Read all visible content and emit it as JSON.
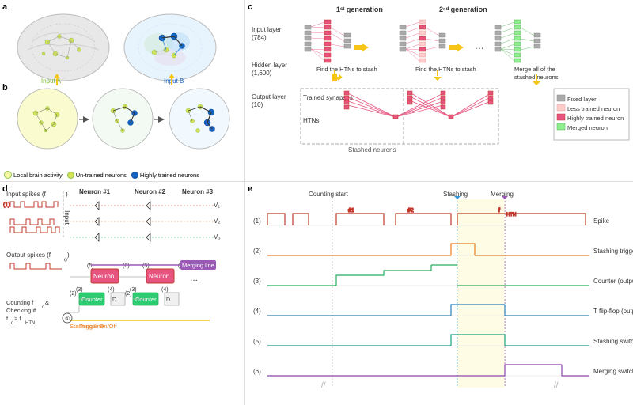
{
  "panels": {
    "a_label": "a",
    "b_label": "b",
    "c_label": "c",
    "d_label": "d",
    "e_label": "e"
  },
  "legend_ab": {
    "local_brain": "Local brain activity",
    "untrained": "Un-trained neurons",
    "highly_trained": "Highly trained neurons"
  },
  "panel_c": {
    "input_layer": "Input layer\n(784)",
    "hidden_layer": "Hidden layer\n(1,600)",
    "output_layer": "Output layer\n(10)",
    "gen1": "1st generation",
    "gen2": "2nd generation",
    "find_htn1": "Find the HTNs to stash",
    "find_htn2": "Find the HTNs to stash",
    "merge_label": "Merge all of the\nstashed neurons",
    "trained_synapses": "Trained synapses",
    "htns": "HTNs",
    "stashed_neurons": "Stashed neurons",
    "legend_fixed": "Fixed layer",
    "legend_less": "Less trained neuron",
    "legend_highly": "Highly trained neuron",
    "legend_merged": "Merged neuron"
  },
  "panel_d": {
    "input_spikes": "Input spikes (fᵢ)",
    "output_spikes": "Output spikes (fₒ)",
    "neuron1": "Neuron #1",
    "neuron2": "Neuron #2",
    "neuron3": "Neuron #3",
    "input_label": "Input",
    "v1": "V₁",
    "v2": "V₂",
    "v3": "V₃",
    "merging_line": "Merging line",
    "stashing_line": "Stashing line",
    "trigger_label": "Trigger On/Off",
    "counting_label": "Counting fₒ &\nChecking if\nfₒ > fHTN",
    "counter_label": "Counter",
    "neuron_label": "Neuron",
    "step2": "(2)",
    "step3": "(3)",
    "step4": "(4)",
    "step5": "(5)",
    "step6": "(6)"
  },
  "panel_e": {
    "counting_start": "Counting start",
    "stashing": "Stashing",
    "merging": "Merging",
    "h1": "#1",
    "h2": "#2",
    "fhtn": "f_HTN",
    "row1_num": "(1)",
    "row2_num": "(2)",
    "row3_num": "(3)",
    "row4_num": "(4)",
    "row5_num": "(5)",
    "row6_num": "(6)",
    "row1_label": "Spike",
    "row2_label": "Stashing trigger",
    "row3_label": "Counter (output)",
    "row4_label": "T flip-flop (output)",
    "row5_label": "Stashing switch",
    "row6_label": "Merging switch"
  },
  "colors": {
    "highly_trained": "#e75480",
    "merged": "#90ee90",
    "fixed": "#aaaaaa",
    "less_trained": "#ffcccc",
    "arrow_yellow": "#f5c518",
    "input_a": "#c8e6c9",
    "input_b": "#b3d9f7",
    "stashing_line": "#f5c518",
    "merging_line": "#9b59b6"
  }
}
